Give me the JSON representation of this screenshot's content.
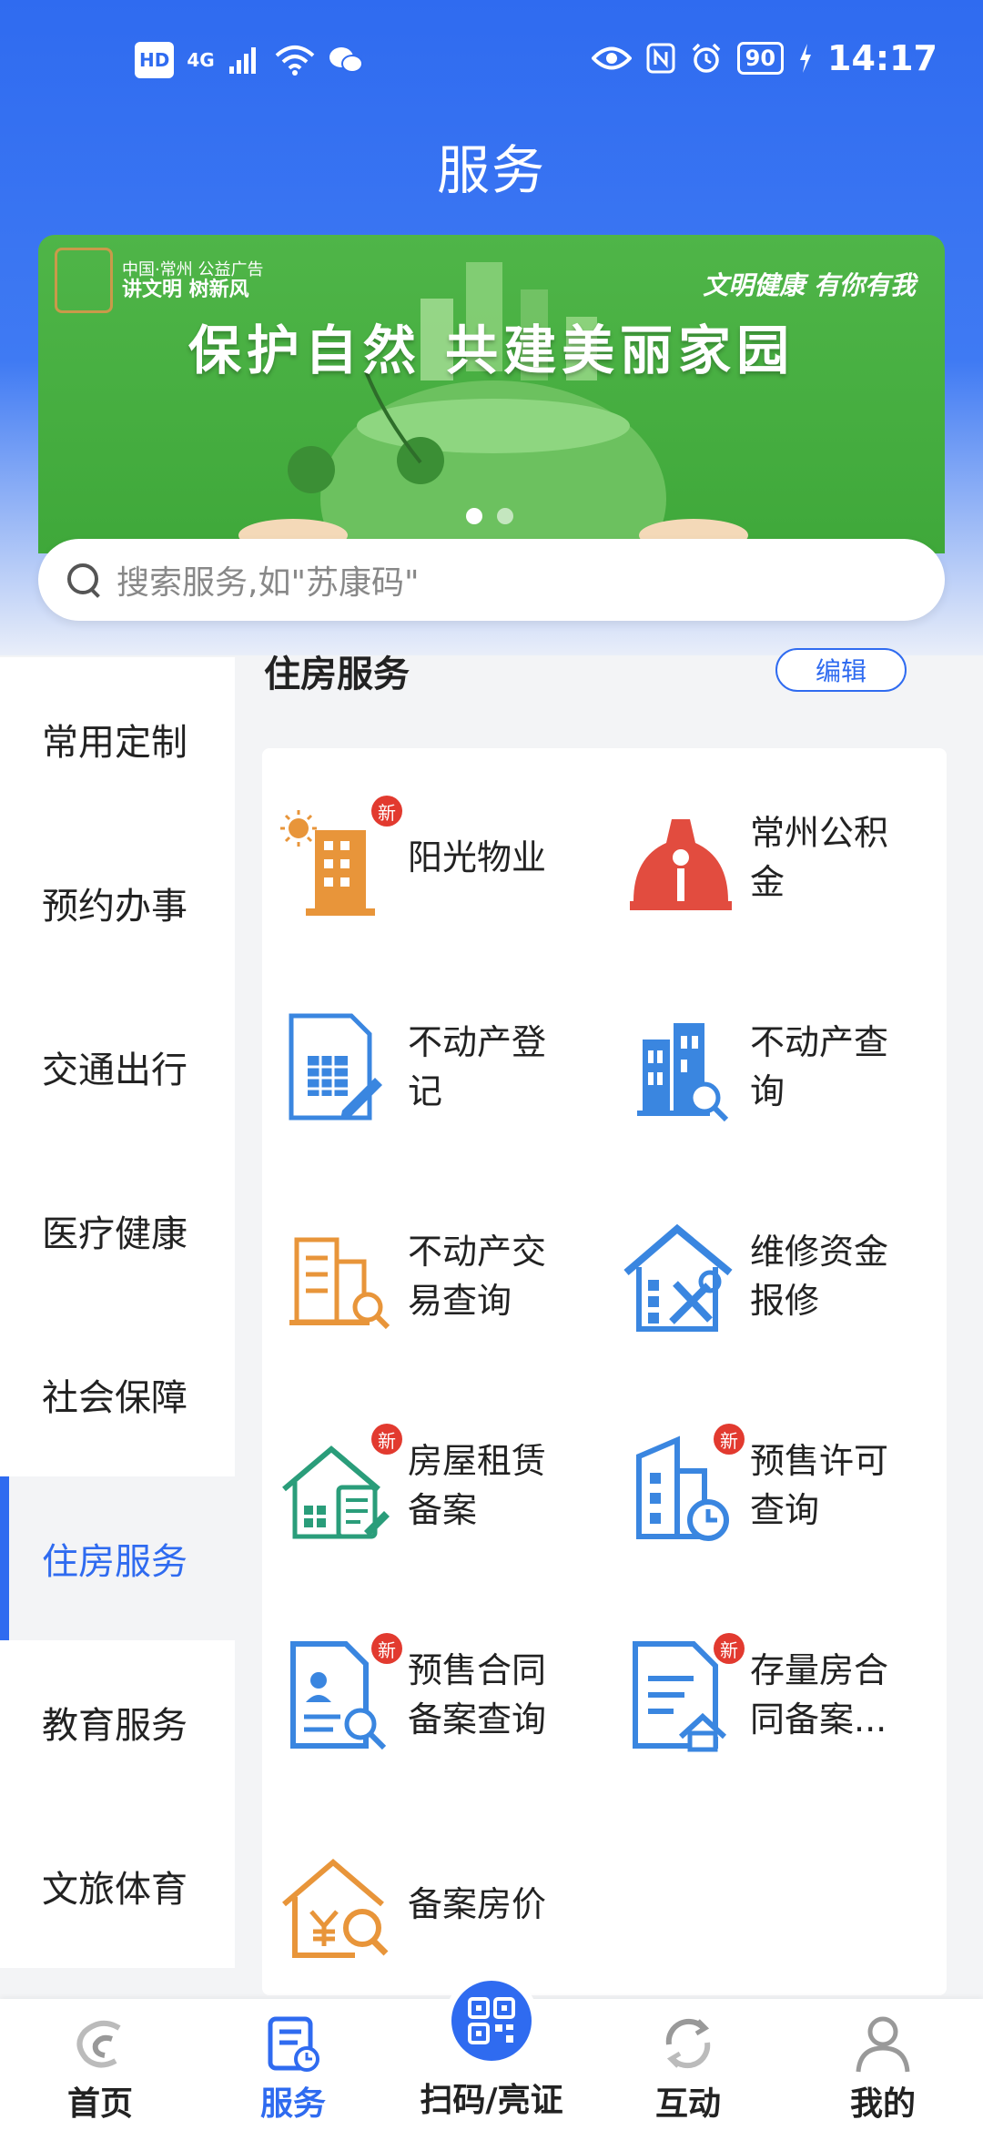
{
  "status_bar": {
    "network": "4G",
    "hd": "HD",
    "battery": "90",
    "time": "14:17",
    "icons": [
      "signal-icon",
      "wifi-icon",
      "wechat-icon",
      "eye-icon",
      "nfc-icon",
      "alarm-icon",
      "battery-icon",
      "charging-icon"
    ]
  },
  "header": {
    "title": "服务"
  },
  "banner": {
    "small_line1": "中国·常州 公益广告",
    "small_line2": "讲文明 树新风",
    "slogan": "文明健康 有你有我",
    "headline": "保护自然 共建美丽家园",
    "dots": 2,
    "active_dot": 0
  },
  "search": {
    "placeholder": "搜索服务,如\"苏康码\""
  },
  "sidebar": {
    "items": [
      {
        "label": "常用定制"
      },
      {
        "label": "预约办事"
      },
      {
        "label": "交通出行"
      },
      {
        "label": "医疗健康"
      },
      {
        "label": "社会保障"
      },
      {
        "label": "住房服务"
      },
      {
        "label": "教育服务"
      },
      {
        "label": "文旅体育"
      }
    ],
    "active_index": 5
  },
  "section": {
    "title": "住房服务",
    "edit_label": "编辑",
    "new_badge": "新",
    "tiles": [
      {
        "label": "阳光物业",
        "icon": "sunshine-building-icon",
        "is_new": true
      },
      {
        "label": "常州公积金",
        "icon": "provident-fund-icon",
        "is_new": false
      },
      {
        "label": "不动产登记",
        "icon": "property-registration-icon",
        "is_new": false
      },
      {
        "label": "不动产查询",
        "icon": "property-query-icon",
        "is_new": false
      },
      {
        "label": "不动产交易查询",
        "icon": "property-transaction-icon",
        "is_new": false
      },
      {
        "label": "维修资金报修",
        "icon": "repair-fund-icon",
        "is_new": false
      },
      {
        "label": "房屋租赁备案",
        "icon": "house-lease-icon",
        "is_new": true
      },
      {
        "label": "预售许可查询",
        "icon": "presale-permit-icon",
        "is_new": true
      },
      {
        "label": "预售合同备案查询",
        "icon": "presale-contract-icon",
        "is_new": true
      },
      {
        "label": "存量房合同备案...",
        "icon": "existing-house-contract-icon",
        "is_new": true
      },
      {
        "label": "备案房价",
        "icon": "filed-price-icon",
        "is_new": false
      }
    ]
  },
  "bottom_nav": {
    "items": [
      {
        "label": "首页",
        "icon": "home-icon"
      },
      {
        "label": "服务",
        "icon": "service-icon"
      },
      {
        "label": "扫码/亮证",
        "icon": "qr-scan-icon"
      },
      {
        "label": "互动",
        "icon": "interact-icon"
      },
      {
        "label": "我的",
        "icon": "profile-icon"
      }
    ],
    "active_index": 1
  },
  "colors": {
    "primary": "#2f6bf0",
    "orange": "#e8953a",
    "red": "#e24c3f",
    "teal": "#2a9d7a",
    "blue_icon": "#3a86e0",
    "badge": "#e23a2f"
  }
}
